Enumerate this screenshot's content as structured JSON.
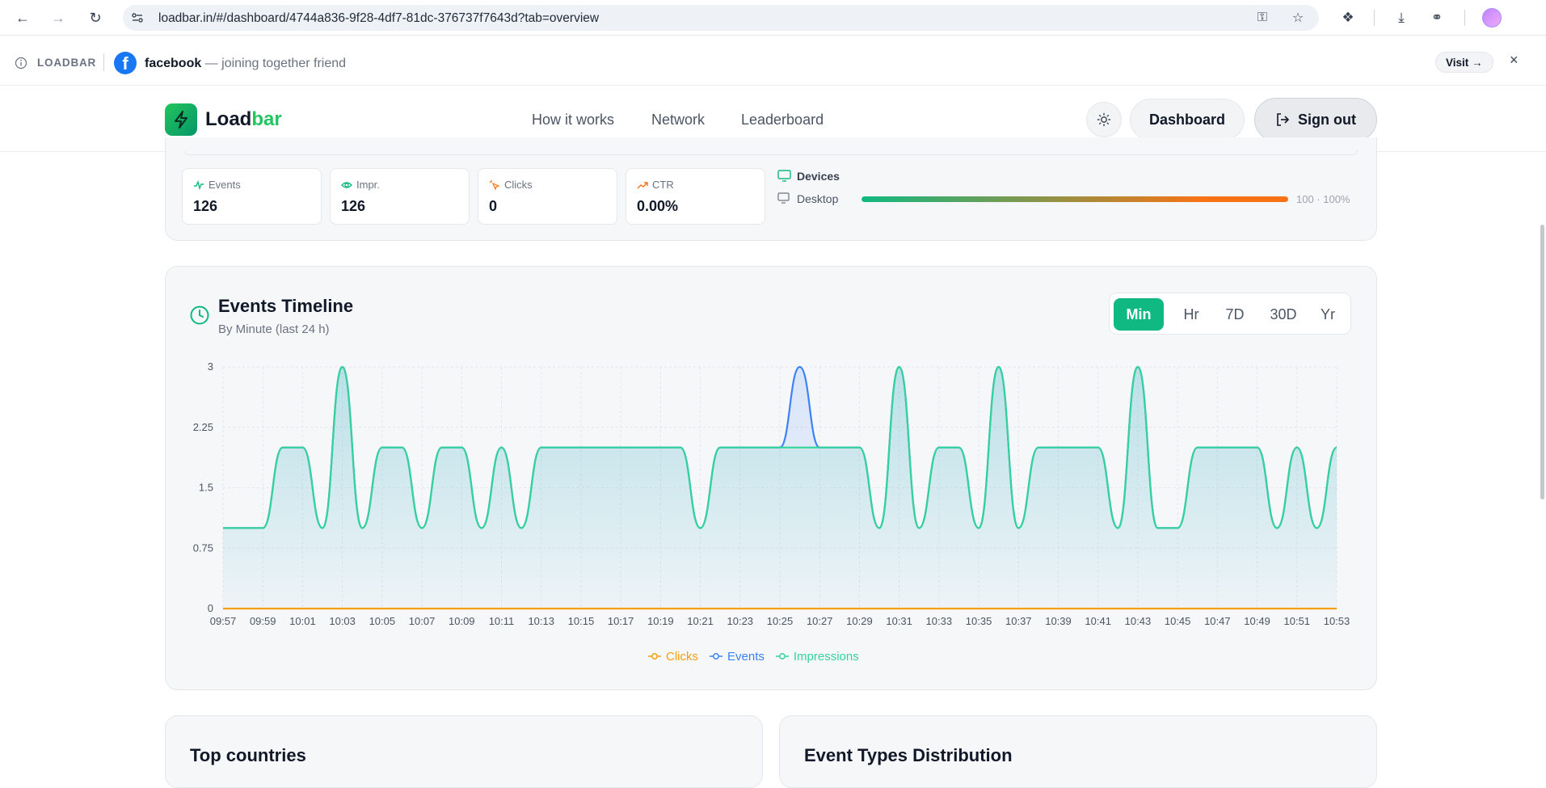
{
  "browser": {
    "url": "loadbar.in/#/dashboard/4744a836-9f28-4df7-81dc-376737f7643d?tab=overview"
  },
  "ad": {
    "brand": "LOADBAR",
    "sponsor_name": "facebook",
    "sponsor_tagline": " — joining together friend",
    "visit_label": "Visit →",
    "close_label": "×"
  },
  "header": {
    "logo_part1": "Load",
    "logo_part2": "bar",
    "nav": [
      "How it works",
      "Network",
      "Leaderboard"
    ],
    "dashboard_label": "Dashboard",
    "signout_label": "Sign out"
  },
  "stats": [
    {
      "label": "Events",
      "value": "126",
      "icon": "activity-icon",
      "color": "#10b981"
    },
    {
      "label": "Impr.",
      "value": "126",
      "icon": "eye-icon",
      "color": "#10b981"
    },
    {
      "label": "Clicks",
      "value": "0",
      "icon": "pointer-icon",
      "color": "#f97316"
    },
    {
      "label": "CTR",
      "value": "0.00%",
      "icon": "trending-up-icon",
      "color": "#f97316"
    }
  ],
  "devices": {
    "title": "Devices",
    "items": [
      {
        "label": "Desktop",
        "value_text": "100 · 100%",
        "share": 1.0
      }
    ]
  },
  "timeline": {
    "title": "Events Timeline",
    "subtitle": "By Minute (last 24 h)",
    "ranges": [
      "Min",
      "Hr",
      "7D",
      "30D",
      "Yr"
    ],
    "active_range": "Min"
  },
  "bottom": {
    "left_title": "Top countries",
    "right_title": "Event Types Distribution"
  },
  "colors": {
    "accent": "#10b981",
    "impressions": "#34d399",
    "events": "#3b82f6",
    "clicks": "#f59e0b"
  },
  "chart_data": {
    "type": "line",
    "title": "Events Timeline",
    "subtitle": "By Minute (last 24 h)",
    "xlabel": "",
    "ylabel": "",
    "ylim": [
      0,
      3
    ],
    "yticks": [
      "0",
      "0.75",
      "1.5",
      "2.25",
      "3"
    ],
    "x_tick_labels": [
      "09:57",
      "09:59",
      "10:01",
      "10:03",
      "10:05",
      "10:07",
      "10:09",
      "10:11",
      "10:13",
      "10:15",
      "10:17",
      "10:19",
      "10:21",
      "10:23",
      "10:25",
      "10:27",
      "10:29",
      "10:31",
      "10:33",
      "10:35",
      "10:37",
      "10:39",
      "10:41",
      "10:43",
      "10:45",
      "10:47",
      "10:49",
      "10:51",
      "10:53"
    ],
    "x": [
      "09:57",
      "09:58",
      "09:59",
      "10:00",
      "10:01",
      "10:02",
      "10:03",
      "10:04",
      "10:05",
      "10:06",
      "10:07",
      "10:08",
      "10:09",
      "10:10",
      "10:11",
      "10:12",
      "10:13",
      "10:14",
      "10:15",
      "10:16",
      "10:17",
      "10:18",
      "10:19",
      "10:20",
      "10:21",
      "10:22",
      "10:23",
      "10:24",
      "10:25",
      "10:26",
      "10:27",
      "10:28",
      "10:29",
      "10:30",
      "10:31",
      "10:32",
      "10:33",
      "10:34",
      "10:35",
      "10:36",
      "10:37",
      "10:38",
      "10:39",
      "10:40",
      "10:41",
      "10:42",
      "10:43",
      "10:44",
      "10:45",
      "10:46",
      "10:47",
      "10:48",
      "10:49",
      "10:50",
      "10:51",
      "10:52",
      "10:53"
    ],
    "grid": true,
    "legend": "bottom-center",
    "series": [
      {
        "name": "Clicks",
        "color": "#f59e0b",
        "values": [
          0,
          0,
          0,
          0,
          0,
          0,
          0,
          0,
          0,
          0,
          0,
          0,
          0,
          0,
          0,
          0,
          0,
          0,
          0,
          0,
          0,
          0,
          0,
          0,
          0,
          0,
          0,
          0,
          0,
          0,
          0,
          0,
          0,
          0,
          0,
          0,
          0,
          0,
          0,
          0,
          0,
          0,
          0,
          0,
          0,
          0,
          0,
          0,
          0,
          0,
          0,
          0,
          0,
          0,
          0,
          0,
          0
        ]
      },
      {
        "name": "Events",
        "color": "#3b82f6",
        "values": [
          1,
          1,
          1,
          2,
          2,
          1,
          3,
          1,
          2,
          2,
          1,
          2,
          2,
          1,
          2,
          1,
          2,
          2,
          2,
          2,
          2,
          2,
          2,
          2,
          1,
          2,
          2,
          2,
          2,
          3,
          2,
          2,
          2,
          1,
          3,
          1,
          2,
          2,
          1,
          3,
          1,
          2,
          2,
          2,
          2,
          1,
          3,
          1,
          1,
          2,
          2,
          2,
          2,
          1,
          2,
          1,
          2
        ]
      },
      {
        "name": "Impressions",
        "color": "#34d399",
        "values": [
          1,
          1,
          1,
          2,
          2,
          1,
          3,
          1,
          2,
          2,
          1,
          2,
          2,
          1,
          2,
          1,
          2,
          2,
          2,
          2,
          2,
          2,
          2,
          2,
          1,
          2,
          2,
          2,
          2,
          2,
          2,
          2,
          2,
          1,
          3,
          1,
          2,
          2,
          1,
          3,
          1,
          2,
          2,
          2,
          2,
          1,
          3,
          1,
          1,
          2,
          2,
          2,
          2,
          1,
          2,
          1,
          2
        ]
      }
    ]
  }
}
